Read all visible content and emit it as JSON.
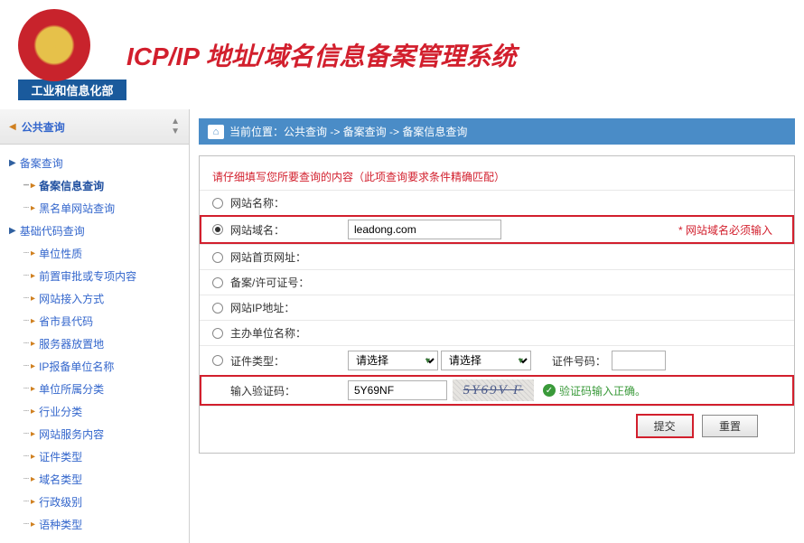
{
  "header": {
    "ministry": "工业和信息化部",
    "systemTitle": "ICP/IP 地址/域名信息备案管理系统"
  },
  "sidebar": {
    "title": "公共查询",
    "groups": [
      {
        "label": "备案查询",
        "items": [
          {
            "label": "备案信息查询",
            "selected": true
          },
          {
            "label": "黑名单网站查询",
            "selected": false
          }
        ]
      },
      {
        "label": "基础代码查询",
        "items": [
          {
            "label": "单位性质",
            "selected": false
          },
          {
            "label": "前置审批或专项内容",
            "selected": false
          },
          {
            "label": "网站接入方式",
            "selected": false
          },
          {
            "label": "省市县代码",
            "selected": false
          },
          {
            "label": "服务器放置地",
            "selected": false
          },
          {
            "label": "IP报备单位名称",
            "selected": false
          },
          {
            "label": "单位所属分类",
            "selected": false
          },
          {
            "label": "行业分类",
            "selected": false
          },
          {
            "label": "网站服务内容",
            "selected": false
          },
          {
            "label": "证件类型",
            "selected": false
          },
          {
            "label": "域名类型",
            "selected": false
          },
          {
            "label": "行政级别",
            "selected": false
          },
          {
            "label": "语种类型",
            "selected": false
          }
        ]
      }
    ]
  },
  "breadcrumb": {
    "prefix": "当前位置：",
    "parts": [
      "公共查询",
      "备案查询",
      "备案信息查询"
    ],
    "sep": "  ->  "
  },
  "form": {
    "instruction": "请仔细填写您所要查询的内容（此项查询要求条件精确匹配）",
    "rows": {
      "siteName": {
        "label": "网站名称：",
        "value": ""
      },
      "domain": {
        "label": "网站域名：",
        "value": "leadong.com",
        "required": "* 网站域名必须输入"
      },
      "homeUrl": {
        "label": "网站首页网址：",
        "value": ""
      },
      "recordNo": {
        "label": "备案/许可证号：",
        "value": ""
      },
      "ip": {
        "label": "网站IP地址：",
        "value": ""
      },
      "sponsor": {
        "label": "主办单位名称：",
        "value": ""
      },
      "certType": {
        "label": "证件类型：",
        "selectPlaceholder": "请选择",
        "certNoLabel": "证件号码：",
        "certNo": ""
      },
      "captcha": {
        "label": "输入验证码：",
        "value": "5Y69NF",
        "image": "5Y69V F",
        "status": "验证码输入正确。"
      }
    },
    "buttons": {
      "submit": "提交",
      "reset": "重置"
    }
  }
}
